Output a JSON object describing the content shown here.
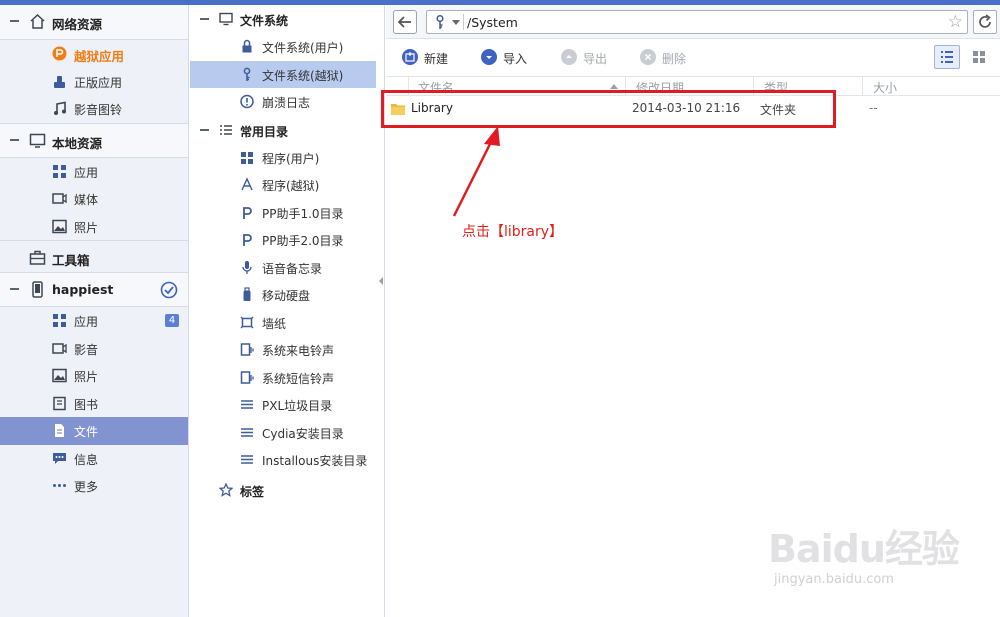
{
  "leftnav": {
    "network": {
      "title": "网络资源",
      "items": [
        {
          "label": "越狱应用",
          "icon": "pp-logo-icon"
        },
        {
          "label": "正版应用",
          "icon": "app-hand-icon"
        },
        {
          "label": "影音图铃",
          "icon": "music-note-icon"
        }
      ]
    },
    "local": {
      "title": "本地资源",
      "items": [
        {
          "label": "应用",
          "icon": "grid-icon"
        },
        {
          "label": "媒体",
          "icon": "video-icon"
        },
        {
          "label": "照片",
          "icon": "photo-icon"
        }
      ]
    },
    "toolbox": {
      "title": "工具箱"
    },
    "device": {
      "title": "happiest",
      "items": [
        {
          "label": "应用",
          "icon": "grid-icon",
          "badge": "4"
        },
        {
          "label": "影音",
          "icon": "video-icon"
        },
        {
          "label": "照片",
          "icon": "photo-icon"
        },
        {
          "label": "图书",
          "icon": "book-icon"
        },
        {
          "label": "文件",
          "icon": "file-icon"
        },
        {
          "label": "信息",
          "icon": "message-icon"
        },
        {
          "label": "更多",
          "icon": "more-dots-icon"
        }
      ]
    }
  },
  "tree": {
    "fs": {
      "title": "文件系统",
      "items": [
        {
          "label": "文件系统(用户)"
        },
        {
          "label": "文件系统(越狱)"
        },
        {
          "label": "崩溃日志"
        }
      ]
    },
    "common": {
      "title": "常用目录",
      "items": [
        {
          "label": "程序(用户)"
        },
        {
          "label": "程序(越狱)"
        },
        {
          "label": "PP助手1.0目录"
        },
        {
          "label": "PP助手2.0目录"
        },
        {
          "label": "语音备忘录"
        },
        {
          "label": "移动硬盘"
        },
        {
          "label": "墙纸"
        },
        {
          "label": "系统来电铃声"
        },
        {
          "label": "系统短信铃声"
        },
        {
          "label": "PXL垃圾目录"
        },
        {
          "label": "Cydia安装目录"
        },
        {
          "label": "Installous安装目录"
        }
      ]
    },
    "tags": {
      "title": "标签"
    }
  },
  "address": {
    "path": "/System"
  },
  "toolbar": {
    "new": "新建",
    "import": "导入",
    "export": "导出",
    "delete": "删除"
  },
  "columns": {
    "name": "文件名",
    "modified": "修改日期",
    "type": "类型",
    "size": "大小"
  },
  "rows": [
    {
      "name": "Library",
      "modified": "2014-03-10 21:16",
      "type": "文件夹",
      "size": "--"
    }
  ],
  "annotation": {
    "text": "点击【library】"
  },
  "watermark": {
    "brand": "Baidu经验",
    "url": "jingyan.baidu.com"
  },
  "colors": {
    "accent": "#4a6fc9",
    "selected": "#8193d0",
    "highlight": "#f07d16",
    "annotation": "#e01b22"
  }
}
